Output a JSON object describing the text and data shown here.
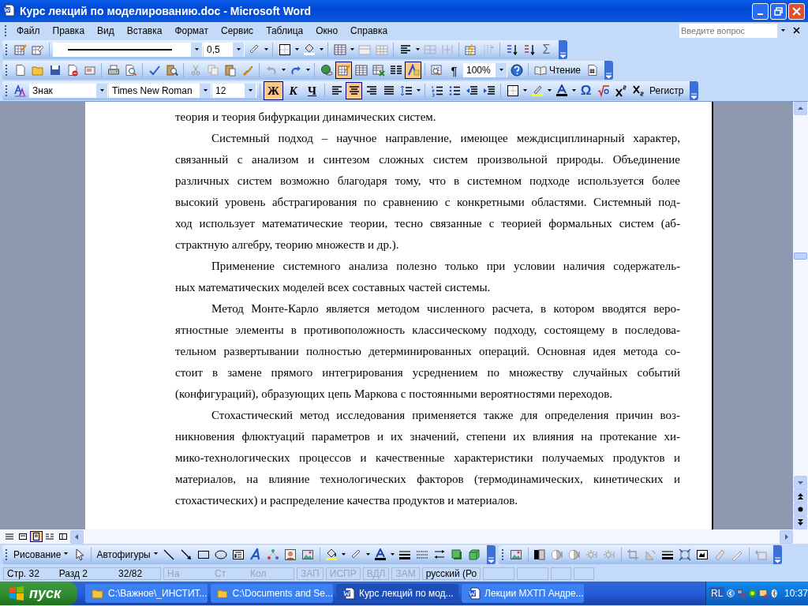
{
  "window": {
    "title": "Курс лекций по моделированию.doc - Microsoft Word"
  },
  "menu": [
    "Файл",
    "Правка",
    "Вид",
    "Вставка",
    "Формат",
    "Сервис",
    "Таблица",
    "Окно",
    "Справка"
  ],
  "help_box": {
    "placeholder": "Введите вопрос"
  },
  "tables_toolbar": {
    "line_weight": "0,5",
    "sigma": "Σ"
  },
  "standard_toolbar": {
    "tables_and_borders": {
      "on": true
    },
    "drawing": {
      "on": true
    },
    "pilcrow": "¶",
    "zoom": "100%",
    "reading": "Чтение"
  },
  "formatting_toolbar": {
    "style": "Знак",
    "font": "Times New Roman",
    "size": "12",
    "bold": {
      "label": "Ж",
      "on": true
    },
    "italic": {
      "label": "К",
      "on": false
    },
    "underline": {
      "label": "Ч",
      "on": false
    },
    "alignment": [
      {
        "selected": false
      },
      {
        "selected": true
      },
      {
        "selected": false
      },
      {
        "selected": false
      }
    ],
    "omega": "Ω",
    "case": "Регистр"
  },
  "document": {
    "paragraphs": [
      {
        "indent": false,
        "lines": [
          "теория и теория бифуркации динамических систем."
        ]
      },
      {
        "indent": true,
        "lines": [
          "Системный подход – научное направление, имеющее междисциплинарный характер,",
          "связанный с анализом и синтезом сложных систем произвольной природы. Объединение",
          "различных систем возможно благодаря тому, что в системном подходе используется более",
          "высокий уровень абстрагирования по сравнению с конкретными областями. Системный под-",
          "ход использует математические теории, тесно связанные с теорией формальных систем (аб-",
          "страктную алгебру, теорию множеств и др.)."
        ]
      },
      {
        "indent": true,
        "lines": [
          "Применение системного анализа полезно только при условии наличия содержатель-",
          "ных математических моделей всех составных частей системы."
        ]
      },
      {
        "indent": true,
        "lines": [
          "Метод Монте-Карло является методом численного расчета, в котором вводятся веро-",
          "ятностные элементы в противоположность классическому подходу, состоящему в последова-",
          "тельном развертывании полностью детерминированных операций. Основная идея метода со-",
          "стоит в замене прямого интегрирования усреднением по множеству случайных событий",
          "(конфигураций), образующих цепь Маркова с постоянными вероятностями переходов."
        ]
      },
      {
        "indent": true,
        "lines": [
          "Стохастический метод исследования применяется также для определения причин воз-",
          "никновения флюктуаций параметров и их значений, степени их влияния на протекание хи-",
          "мико-технологических процессов и качественные характеристики получаемых продуктов и",
          "материалов, на влияние технологических факторов (термодинамических, кинетических и",
          "стохастических) и распределение качества продуктов и материалов."
        ]
      }
    ]
  },
  "view_buttons": [
    {
      "selected": false
    },
    {
      "selected": false
    },
    {
      "selected": true
    },
    {
      "selected": false
    },
    {
      "selected": false
    }
  ],
  "drawing_toolbar": {
    "draw_menu": "Рисование",
    "autoshapes": "Автофигуры"
  },
  "status_bar": {
    "page": "Стр. 32",
    "section": "Разд 2",
    "pages": "32/82",
    "at": "На",
    "line": "Ст",
    "column": "Кол",
    "modes": [
      {
        "label": "ЗАП",
        "on": false
      },
      {
        "label": "ИСПР",
        "on": false
      },
      {
        "label": "ВДЛ",
        "on": false
      },
      {
        "label": "ЗАМ",
        "on": false
      }
    ],
    "language": "русский (Ро"
  },
  "taskbar": {
    "start": "пуск",
    "tasks": [
      {
        "kind": "folder",
        "label": "C:\\Важное\\_ИНСТИТ...",
        "selected": false
      },
      {
        "kind": "folder",
        "label": "C:\\Documents and Se...",
        "selected": false
      },
      {
        "kind": "word",
        "label": "Курс лекций по мод...",
        "selected": true
      },
      {
        "kind": "word",
        "label": "Лекции МХТП Андре...",
        "selected": false
      }
    ],
    "keyboard": "RL",
    "clock": "10:37"
  }
}
